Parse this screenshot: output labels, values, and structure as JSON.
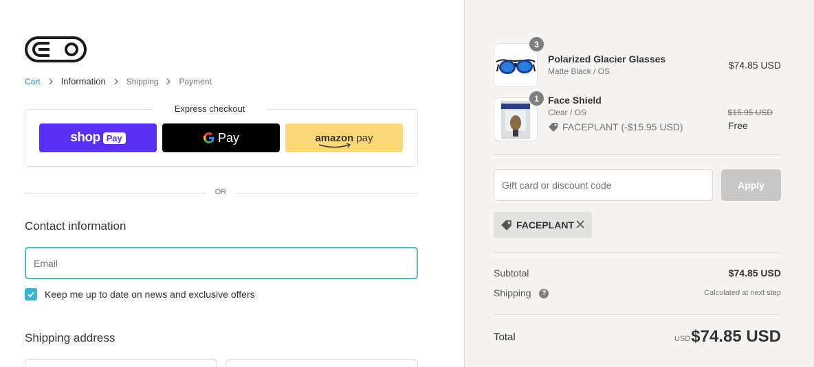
{
  "brand": {
    "logo_icon": "goggle-logo-icon"
  },
  "breadcrumb": [
    {
      "label": "Cart"
    },
    {
      "label": "Information"
    },
    {
      "label": "Shipping"
    },
    {
      "label": "Payment"
    }
  ],
  "express": {
    "title": "Express checkout",
    "shop_pay": {
      "word": "shop",
      "pill": "Pay"
    },
    "google_pay": {
      "word": "Pay"
    },
    "amazon_pay": {
      "word": "amazon",
      "pay": "pay"
    }
  },
  "or_label": "OR",
  "contact": {
    "title": "Contact information",
    "email_placeholder": "Email",
    "newsletter_label": "Keep me up to date on news and exclusive offers",
    "newsletter_checked": true
  },
  "shipping": {
    "title": "Shipping address"
  },
  "order": {
    "items": [
      {
        "name": "Polarized Glacier Glasses",
        "variant": "Matte Black / OS",
        "quantity": "3",
        "price": "$74.85 USD",
        "icon": "glasses-icon"
      },
      {
        "name": "Face Shield",
        "variant": "Clear / OS",
        "quantity": "1",
        "discount": "FACEPLANT (-$15.95 USD)",
        "original_price": "$15.95 USD",
        "price": "Free",
        "icon": "face-shield-icon"
      }
    ],
    "discount_placeholder": "Gift card or discount code",
    "apply_label": "Apply",
    "applied_code": "FACEPLANT"
  },
  "summary": {
    "subtotal_label": "Subtotal",
    "subtotal_value": "$74.85 USD",
    "shipping_label": "Shipping",
    "shipping_help": "?",
    "shipping_value": "Calculated at next step",
    "total_label": "Total",
    "total_currency": "USD",
    "total_value": "$74.85 USD"
  },
  "colors": {
    "link": "#2d8ab3",
    "shop_pay": "#5a31f4",
    "google_pay": "#000000",
    "amazon_pay": "#fcd877",
    "focus": "#54b9c6",
    "checkbox": "#3db3d2",
    "sidebar_bg": "#f5f4f3"
  }
}
